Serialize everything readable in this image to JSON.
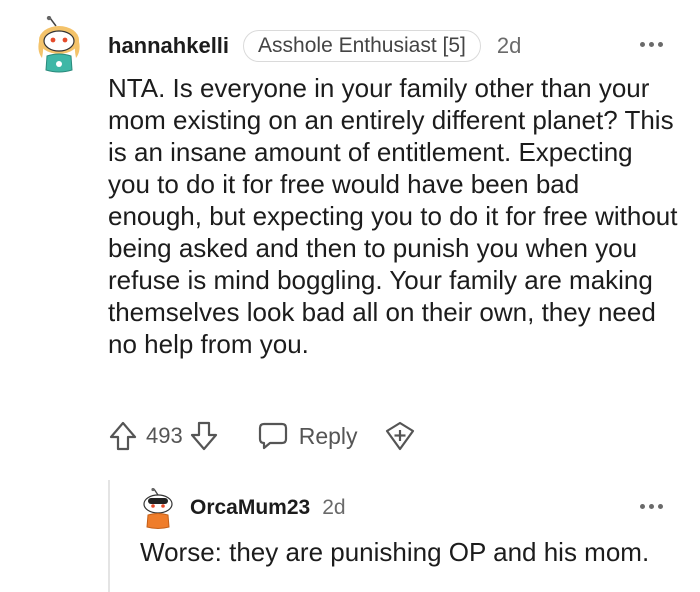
{
  "comment": {
    "username": "hannahkelli",
    "flair": "Asshole Enthusiast [5]",
    "time": "2d",
    "body": "NTA. Is everyone in your family other than your mom existing on an entirely different planet? This is an insane amount of entitlement. Expecting you to do it for free would have been bad enough, but expecting you to do it for free without being asked and then to punish you when you refuse is mind boggling. Your family are making themselves look bad all on their own, they need no help from you.",
    "votes": "493",
    "reply_label": "Reply",
    "icons": {
      "avatar": "snoo-avatar-icon",
      "more": "more-options-icon",
      "upvote": "upvote-arrow-icon",
      "downvote": "downvote-arrow-icon",
      "reply": "speech-bubble-icon",
      "award": "award-plus-icon"
    }
  },
  "reply": {
    "username": "OrcaMum23",
    "time": "2d",
    "body": "Worse: they are punishing OP and his mom.",
    "icons": {
      "avatar": "snoo-avatar-icon",
      "more": "more-options-icon"
    }
  },
  "colors": {
    "text": "#1c1c1c",
    "meta": "#6a6a6a",
    "icon": "#555555",
    "flair_border": "#dadada",
    "thread_line": "#e4e4e4"
  }
}
